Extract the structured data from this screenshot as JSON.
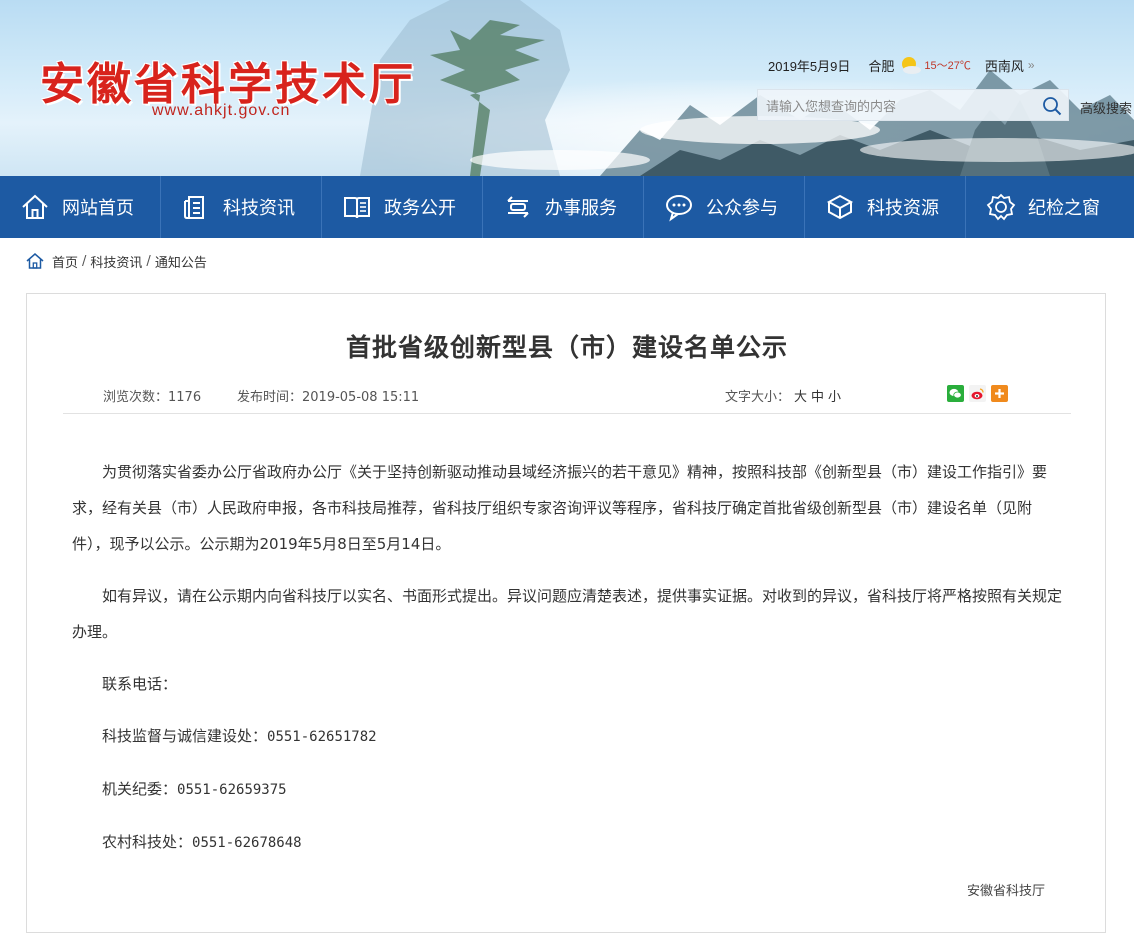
{
  "header": {
    "site_name": "安徽省科学技术厅",
    "site_url": "www.ahkjt.gov.cn",
    "weather": {
      "date": "2019年5月9日",
      "city": "合肥",
      "temperature": "15～27℃",
      "wind": "西南风",
      "icon": "sun-cloud-icon"
    },
    "search": {
      "placeholder": "请输入您想查询的内容"
    },
    "advanced_search": "高级搜索"
  },
  "nav": {
    "items": [
      {
        "label": "网站首页",
        "icon": "home-icon"
      },
      {
        "label": "科技资讯",
        "icon": "document-icon"
      },
      {
        "label": "政务公开",
        "icon": "book-icon"
      },
      {
        "label": "办事服务",
        "icon": "service-icon"
      },
      {
        "label": "公众参与",
        "icon": "chat-icon"
      },
      {
        "label": "科技资源",
        "icon": "cube-icon"
      },
      {
        "label": "纪检之窗",
        "icon": "badge-icon"
      }
    ],
    "color": "#1d5aa3"
  },
  "breadcrumb": {
    "items": [
      "首页",
      "科技资讯",
      "通知公告"
    ],
    "separator": "/"
  },
  "article": {
    "title": "首批省级创新型县（市）建设名单公示",
    "views_label": "浏览次数：",
    "views": "1176",
    "publish_label": "发布时间：",
    "publish_time": "2019-05-08 15:11",
    "font_size_label": "文字大小：",
    "font_sizes": [
      "大",
      "中",
      "小"
    ],
    "share_icons": [
      "wechat-icon",
      "weibo-icon",
      "plus-share-icon"
    ],
    "paragraphs": [
      "为贯彻落实省委办公厅省政府办公厅《关于坚持创新驱动推动县域经济振兴的若干意见》精神，按照科技部《创新型县（市）建设工作指引》要求，经有关县（市）人民政府申报，各市科技局推荐，省科技厅组织专家咨询评议等程序，省科技厅确定首批省级创新型县（市）建设名单（见附件），现予以公示。公示期为2019年5月8日至5月14日。",
      "如有异议，请在公示期内向省科技厅以实名、书面形式提出。异议问题应清楚表述，提供事实证据。对收到的异议，省科技厅将严格按照有关规定办理。"
    ],
    "contact_heading": "联系电话：",
    "contacts": [
      {
        "dept": "科技监督与诚信建设处：",
        "phone": "0551-62651782"
      },
      {
        "dept": "机关纪委：",
        "phone": "0551-62659375"
      },
      {
        "dept": "农村科技处：",
        "phone": "0551-62678648"
      }
    ],
    "signature": "安徽省科技厅"
  }
}
